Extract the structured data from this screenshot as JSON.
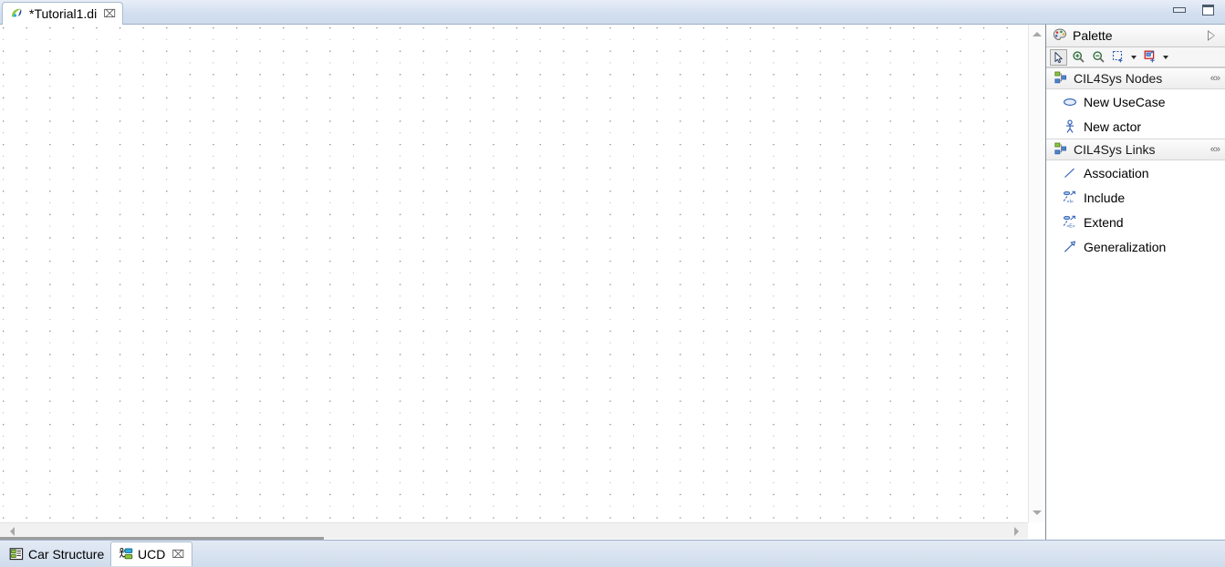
{
  "window": {
    "minimize_label": "Minimize",
    "maximize_label": "Restore"
  },
  "editor_tab": {
    "title": "*Tutorial1.di",
    "close_glyph": "⌧",
    "icon": "papyrus-icon"
  },
  "palette": {
    "title": "Palette",
    "collapse_label": "▷",
    "toolbar": {
      "buttons": [
        {
          "name": "select-tool",
          "label": "Select",
          "selected": true
        },
        {
          "name": "zoom-in-tool",
          "label": "Zoom In",
          "selected": false
        },
        {
          "name": "zoom-out-tool",
          "label": "Zoom Out",
          "selected": false
        },
        {
          "name": "marquee-tool",
          "label": "Marquee",
          "selected": false
        },
        {
          "name": "format-tool",
          "label": "Create Element",
          "selected": false
        }
      ]
    },
    "sections": [
      {
        "title": "CIL4Sys Nodes",
        "pin_glyph": "«»",
        "items": [
          {
            "label": "New UseCase",
            "icon": "usecase-ellipse-icon"
          },
          {
            "label": "New actor",
            "icon": "actor-stickfigure-icon"
          }
        ]
      },
      {
        "title": "CIL4Sys Links",
        "pin_glyph": "«»",
        "items": [
          {
            "label": "Association",
            "icon": "association-line-icon"
          },
          {
            "label": "Include",
            "icon": "include-arrow-icon"
          },
          {
            "label": "Extend",
            "icon": "extend-arrow-icon"
          },
          {
            "label": "Generalization",
            "icon": "generalization-arrow-icon"
          }
        ]
      }
    ]
  },
  "canvas": {
    "vertical_scrollbar": {
      "up_label": "Scroll up",
      "down_label": "Scroll down"
    },
    "horizontal_scrollbar": {
      "left_label": "Scroll left",
      "right_label": "Scroll right"
    }
  },
  "bottom_tabs": [
    {
      "label": "Car Structure",
      "icon": "class-diagram-icon",
      "active": false,
      "closable": false
    },
    {
      "label": "UCD",
      "icon": "usecase-diagram-icon",
      "active": true,
      "closable": true,
      "close_glyph": "⌧"
    }
  ],
  "colors": {
    "tabbar_blue": "#cddcee",
    "palette_icon_blue": "#3a63a8",
    "selection_border": "#a6a6a6"
  }
}
